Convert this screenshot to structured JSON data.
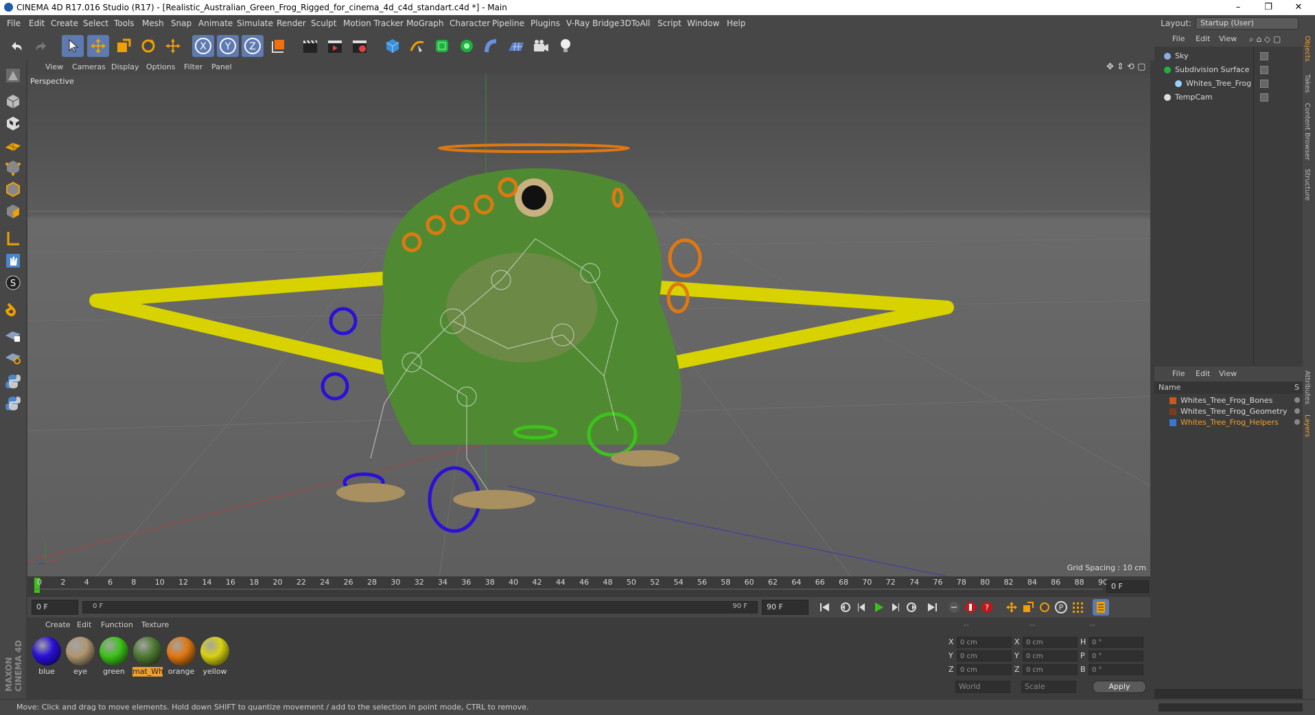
{
  "window": {
    "title": "CINEMA 4D R17.016 Studio (R17) - [Realistic_Australian_Green_Frog_Rigged_for_cinema_4d_c4d_standart.c4d *] - Main",
    "minimize": "–",
    "restore": "❐",
    "close": "✕"
  },
  "menu": [
    "File",
    "Edit",
    "Create",
    "Select",
    "Tools",
    "Mesh",
    "Snap",
    "Animate",
    "Simulate",
    "Render",
    "Sculpt",
    "Motion Tracker",
    "MoGraph",
    "Character",
    "Pipeline",
    "Plugins",
    "V-Ray Bridge",
    "3DToAll",
    "Script",
    "Window",
    "Help"
  ],
  "layout": {
    "label": "Layout:",
    "value": "Startup (User)"
  },
  "viewport": {
    "menu": [
      "View",
      "Cameras",
      "Display",
      "Options",
      "Filter",
      "Panel"
    ],
    "label": "Perspective",
    "grid_spacing": "Grid Spacing : 10 cm"
  },
  "timeline": {
    "ticks": [
      "0",
      "2",
      "4",
      "6",
      "8",
      "10",
      "12",
      "14",
      "16",
      "18",
      "20",
      "22",
      "24",
      "26",
      "28",
      "30",
      "32",
      "34",
      "36",
      "38",
      "40",
      "42",
      "44",
      "46",
      "48",
      "50",
      "52",
      "54",
      "56",
      "58",
      "60",
      "62",
      "64",
      "66",
      "68",
      "70",
      "72",
      "74",
      "76",
      "78",
      "80",
      "82",
      "84",
      "86",
      "88",
      "90"
    ],
    "current_frame": "0 F",
    "start_field": "0 F",
    "range_start": "0 F",
    "range_end": "90 F",
    "end_field": "90 F"
  },
  "materials": {
    "menu": [
      "Create",
      "Edit",
      "Function",
      "Texture"
    ],
    "items": [
      {
        "label": "blue",
        "color": "#2a10d8"
      },
      {
        "label": "eye",
        "color": "#b09670"
      },
      {
        "label": "green",
        "color": "#3cc21a"
      },
      {
        "label": "mat_Wh",
        "color": "#4f7a32"
      },
      {
        "label": "orange",
        "color": "#e07812"
      },
      {
        "label": "yellow",
        "color": "#d8d212"
      }
    ]
  },
  "coords": {
    "headers": [
      "--",
      "--",
      "--"
    ],
    "rows": [
      {
        "l1": "X",
        "v1": "0 cm",
        "l2": "X",
        "v2": "0 cm",
        "l3": "H",
        "v3": "0 °"
      },
      {
        "l1": "Y",
        "v1": "0 cm",
        "l2": "Y",
        "v2": "0 cm",
        "l3": "P",
        "v3": "0 °"
      },
      {
        "l1": "Z",
        "v1": "0 cm",
        "l2": "Z",
        "v2": "0 cm",
        "l3": "B",
        "v3": "0 °"
      }
    ],
    "world": "World",
    "scale": "Scale",
    "apply": "Apply"
  },
  "objects": {
    "menu": [
      "File",
      "Edit",
      "View"
    ],
    "items": [
      {
        "name": "Sky",
        "indent": 0
      },
      {
        "name": "Subdivision Surface",
        "indent": 0
      },
      {
        "name": "Whites_Tree_Frog",
        "indent": 1
      },
      {
        "name": "TempCam",
        "indent": 0
      }
    ]
  },
  "layers": {
    "menu": [
      "File",
      "Edit",
      "View"
    ],
    "col_name": "Name",
    "col_s": "S",
    "items": [
      {
        "name": "Whites_Tree_Frog_Bones",
        "color": "#c8581c"
      },
      {
        "name": "Whites_Tree_Frog_Geometry",
        "color": "#7a3a1c"
      },
      {
        "name": "Whites_Tree_Frog_Helpers",
        "color": "#3a78d0"
      }
    ]
  },
  "sidetabs": [
    "Objects",
    "Takes",
    "Content Browser",
    "Structure",
    "Attributes",
    "Layers"
  ],
  "status": "Move: Click and drag to move elements. Hold down SHIFT to quantize movement / add to the selection in point mode, CTRL to remove.",
  "brand": "MAXON CINEMA 4D",
  "colors": {
    "accent": "#5e7ab0",
    "helper_layer": "#f0a030"
  }
}
